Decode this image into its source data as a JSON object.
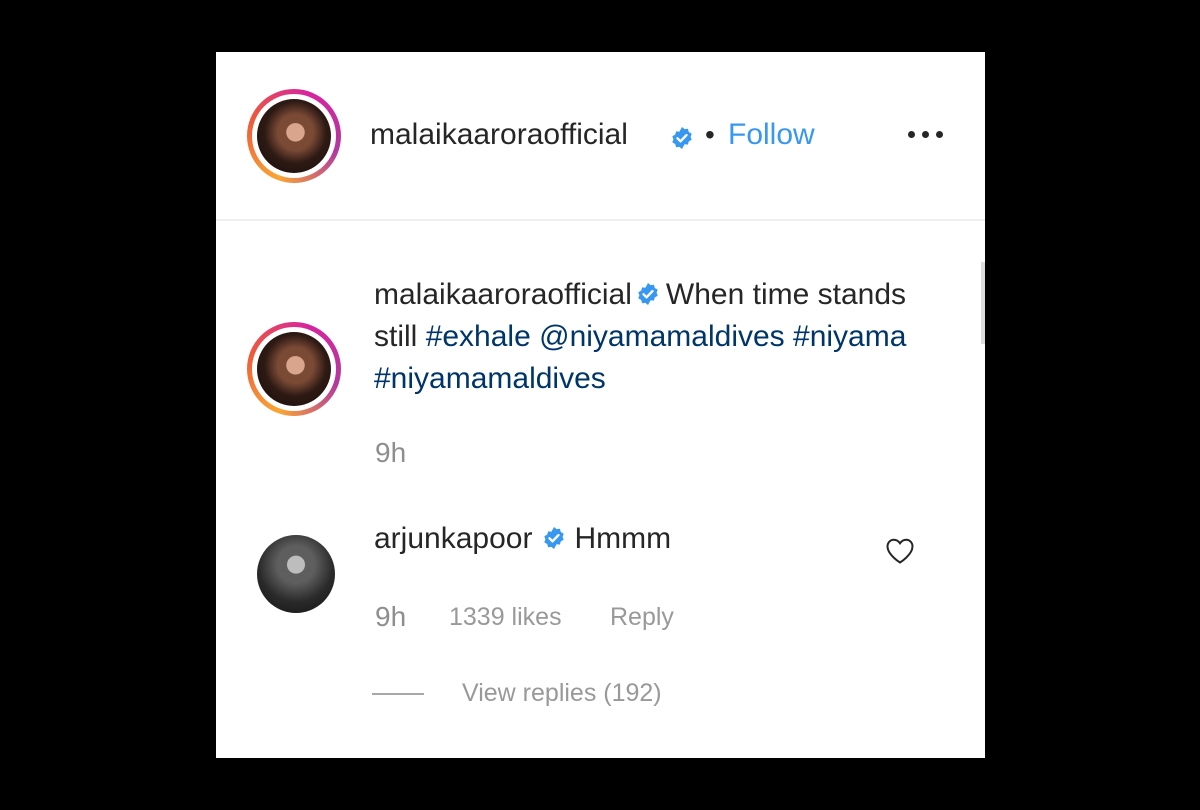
{
  "header": {
    "username": "malaikaaroraofficial",
    "separator": "•",
    "follow_label": "Follow",
    "more_icon": "more-horizontal-icon"
  },
  "caption": {
    "username": "malaikaaroraofficial",
    "text": "When time stands still",
    "tag1": "#exhale",
    "mention": "@niyamamaldives",
    "tag2": "#niyama",
    "tag3": "#niyamamaldives",
    "time": "9h"
  },
  "comment": {
    "username": "arjunkapoor",
    "text": "Hmmm",
    "time": "9h",
    "likes": "1339 likes",
    "reply_label": "Reply",
    "view_replies": "View replies (192)"
  },
  "colors": {
    "link": "#3897f0",
    "hashtag": "#003569",
    "verified": "#3897f0",
    "muted": "#8e8e8e"
  }
}
